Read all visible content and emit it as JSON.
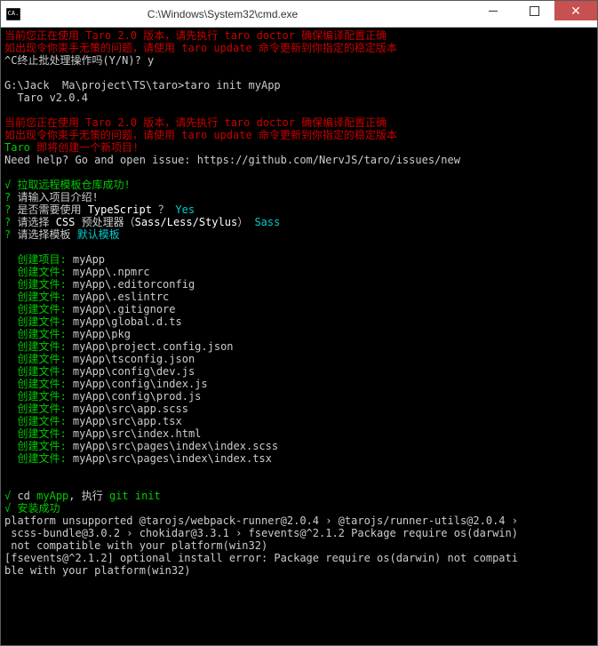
{
  "titlebar": {
    "title": "C:\\Windows\\System32\\cmd.exe"
  },
  "lines": [
    {
      "spans": [
        {
          "cls": "red",
          "t": "当前您正在使用 Taro 2.0 版本，请先执行 taro doctor 确保编译配置正确"
        }
      ]
    },
    {
      "spans": [
        {
          "cls": "red",
          "t": "如出现令你束手无策的问题，请使用 taro update 命令更新到你指定的稳定版本"
        }
      ]
    },
    {
      "spans": [
        {
          "cls": "gray",
          "t": "^C终止批处理操作吗(Y/N)? y"
        }
      ]
    },
    {
      "spans": [
        {
          "cls": "gray",
          "t": ""
        }
      ]
    },
    {
      "spans": [
        {
          "cls": "gray",
          "t": "G:\\Jack  Ma\\project\\TS\\taro>taro init myApp"
        }
      ]
    },
    {
      "spans": [
        {
          "cls": "gray",
          "t": "  Taro v2.0.4"
        }
      ]
    },
    {
      "spans": [
        {
          "cls": "gray",
          "t": ""
        }
      ]
    },
    {
      "spans": [
        {
          "cls": "red",
          "t": "当前您正在使用 Taro 2.0 版本，请先执行 taro doctor 确保编译配置正确"
        }
      ]
    },
    {
      "spans": [
        {
          "cls": "red",
          "t": "如出现令你束手无策的问题，请使用 taro update 命令更新到你指定的稳定版本"
        }
      ]
    },
    {
      "spans": [
        {
          "cls": "green",
          "t": "Taro "
        },
        {
          "cls": "red",
          "t": "即将创建一个新项目!"
        }
      ]
    },
    {
      "spans": [
        {
          "cls": "gray",
          "t": "Need help? Go and open issue: https://github.com/NervJS/taro/issues/new"
        }
      ]
    },
    {
      "spans": [
        {
          "cls": "gray",
          "t": ""
        }
      ]
    },
    {
      "spans": [
        {
          "cls": "green",
          "t": "√ 拉取远程模板仓库成功!"
        }
      ]
    },
    {
      "spans": [
        {
          "cls": "green",
          "t": "? "
        },
        {
          "cls": "gray",
          "t": "请输入项目介绍!"
        }
      ]
    },
    {
      "spans": [
        {
          "cls": "green",
          "t": "? "
        },
        {
          "cls": "gray",
          "t": "是否需要使用 "
        },
        {
          "cls": "white",
          "t": "TypeScript "
        },
        {
          "cls": "gray",
          "t": "？ "
        },
        {
          "cls": "cyan",
          "t": "Yes"
        }
      ]
    },
    {
      "spans": [
        {
          "cls": "green",
          "t": "? "
        },
        {
          "cls": "gray",
          "t": "请选择 "
        },
        {
          "cls": "white",
          "t": "CSS "
        },
        {
          "cls": "gray",
          "t": "预处理器（"
        },
        {
          "cls": "white",
          "t": "Sass/Less/Stylus"
        },
        {
          "cls": "gray",
          "t": "） "
        },
        {
          "cls": "cyan",
          "t": "Sass"
        }
      ]
    },
    {
      "spans": [
        {
          "cls": "green",
          "t": "? "
        },
        {
          "cls": "gray",
          "t": "请选择模板 "
        },
        {
          "cls": "cyan",
          "t": "默认模板"
        }
      ]
    },
    {
      "spans": [
        {
          "cls": "gray",
          "t": ""
        }
      ]
    },
    {
      "spans": [
        {
          "cls": "green",
          "t": "  创建项目: "
        },
        {
          "cls": "gray",
          "t": "myApp"
        }
      ]
    },
    {
      "spans": [
        {
          "cls": "green",
          "t": "  创建文件: "
        },
        {
          "cls": "gray",
          "t": "myApp\\.npmrc"
        }
      ]
    },
    {
      "spans": [
        {
          "cls": "green",
          "t": "  创建文件: "
        },
        {
          "cls": "gray",
          "t": "myApp\\.editorconfig"
        }
      ]
    },
    {
      "spans": [
        {
          "cls": "green",
          "t": "  创建文件: "
        },
        {
          "cls": "gray",
          "t": "myApp\\.eslintrc"
        }
      ]
    },
    {
      "spans": [
        {
          "cls": "green",
          "t": "  创建文件: "
        },
        {
          "cls": "gray",
          "t": "myApp\\.gitignore"
        }
      ]
    },
    {
      "spans": [
        {
          "cls": "green",
          "t": "  创建文件: "
        },
        {
          "cls": "gray",
          "t": "myApp\\global.d.ts"
        }
      ]
    },
    {
      "spans": [
        {
          "cls": "green",
          "t": "  创建文件: "
        },
        {
          "cls": "gray",
          "t": "myApp\\pkg"
        }
      ]
    },
    {
      "spans": [
        {
          "cls": "green",
          "t": "  创建文件: "
        },
        {
          "cls": "gray",
          "t": "myApp\\project.config.json"
        }
      ]
    },
    {
      "spans": [
        {
          "cls": "green",
          "t": "  创建文件: "
        },
        {
          "cls": "gray",
          "t": "myApp\\tsconfig.json"
        }
      ]
    },
    {
      "spans": [
        {
          "cls": "green",
          "t": "  创建文件: "
        },
        {
          "cls": "gray",
          "t": "myApp\\config\\dev.js"
        }
      ]
    },
    {
      "spans": [
        {
          "cls": "green",
          "t": "  创建文件: "
        },
        {
          "cls": "gray",
          "t": "myApp\\config\\index.js"
        }
      ]
    },
    {
      "spans": [
        {
          "cls": "green",
          "t": "  创建文件: "
        },
        {
          "cls": "gray",
          "t": "myApp\\config\\prod.js"
        }
      ]
    },
    {
      "spans": [
        {
          "cls": "green",
          "t": "  创建文件: "
        },
        {
          "cls": "gray",
          "t": "myApp\\src\\app.scss"
        }
      ]
    },
    {
      "spans": [
        {
          "cls": "green",
          "t": "  创建文件: "
        },
        {
          "cls": "gray",
          "t": "myApp\\src\\app.tsx"
        }
      ]
    },
    {
      "spans": [
        {
          "cls": "green",
          "t": "  创建文件: "
        },
        {
          "cls": "gray",
          "t": "myApp\\src\\index.html"
        }
      ]
    },
    {
      "spans": [
        {
          "cls": "green",
          "t": "  创建文件: "
        },
        {
          "cls": "gray",
          "t": "myApp\\src\\pages\\index\\index.scss"
        }
      ]
    },
    {
      "spans": [
        {
          "cls": "green",
          "t": "  创建文件: "
        },
        {
          "cls": "gray",
          "t": "myApp\\src\\pages\\index\\index.tsx"
        }
      ]
    },
    {
      "spans": [
        {
          "cls": "gray",
          "t": ""
        }
      ]
    },
    {
      "spans": [
        {
          "cls": "gray",
          "t": ""
        }
      ]
    },
    {
      "spans": [
        {
          "cls": "green",
          "t": "√ "
        },
        {
          "cls": "gray",
          "t": "cd "
        },
        {
          "cls": "green",
          "t": "myApp"
        },
        {
          "cls": "gray",
          "t": ", 执行 "
        },
        {
          "cls": "green",
          "t": "git init"
        }
      ]
    },
    {
      "spans": [
        {
          "cls": "green",
          "t": "√ 安装成功"
        }
      ]
    },
    {
      "spans": [
        {
          "cls": "gray",
          "t": "platform unsupported @tarojs/webpack-runner@2.0.4 › @tarojs/runner-utils@2.0.4 ›"
        }
      ]
    },
    {
      "spans": [
        {
          "cls": "gray",
          "t": " scss-bundle@3.0.2 › chokidar@3.3.1 › fsevents@^2.1.2 Package require os(darwin)"
        }
      ]
    },
    {
      "spans": [
        {
          "cls": "gray",
          "t": " not compatible with your platform(win32)"
        }
      ]
    },
    {
      "spans": [
        {
          "cls": "gray",
          "t": "[fsevents@^2.1.2] optional install error: Package require os(darwin) not compati"
        }
      ]
    },
    {
      "spans": [
        {
          "cls": "gray",
          "t": "ble with your platform(win32)"
        }
      ]
    }
  ]
}
